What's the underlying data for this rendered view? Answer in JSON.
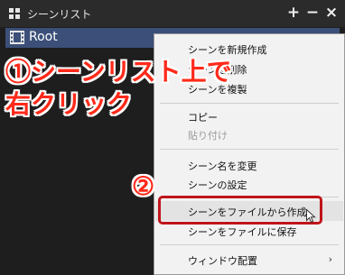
{
  "window": {
    "title": "シーンリスト",
    "add_button": "+",
    "minimize_button": "−",
    "close_button": "×"
  },
  "tree": {
    "root_label": "Root"
  },
  "annotations": {
    "step1_line1": "①シーンリスト上で",
    "step1_line2": "右クリック",
    "step2": "②"
  },
  "context_menu": {
    "items": [
      {
        "label": "シーンを新規作成",
        "enabled": true
      },
      {
        "label": "シーンを削除",
        "enabled": true
      },
      {
        "label": "シーンを複製",
        "enabled": true
      },
      {
        "label": "コピー",
        "enabled": true
      },
      {
        "label": "貼り付け",
        "enabled": false
      },
      {
        "label": "シーン名を変更",
        "enabled": true
      },
      {
        "label": "シーンの設定",
        "enabled": true
      },
      {
        "label": "シーンをファイルから作成",
        "enabled": true,
        "hovered": true
      },
      {
        "label": "シーンをファイルに保存",
        "enabled": true
      },
      {
        "label": "ウィンドウ配置",
        "enabled": true,
        "submenu": true
      }
    ],
    "submenu_arrow": "›"
  },
  "colors": {
    "annotation_red": "#ff2a1a",
    "highlight_border": "#c0141a",
    "selected_row": "#3b4f78"
  }
}
